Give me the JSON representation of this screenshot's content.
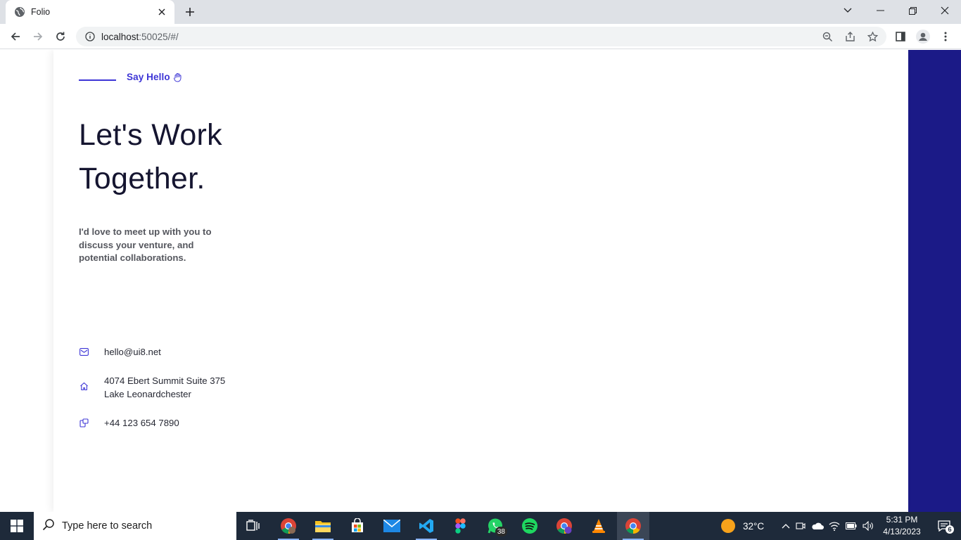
{
  "browser": {
    "tab_title": "Folio",
    "url_host": "localhost",
    "url_rest": ":50025/#/"
  },
  "page": {
    "eyebrow": "Say Hello",
    "headline": [
      "Let's Work",
      "Together."
    ],
    "intro": "I'd love to meet up with you to discuss your venture, and potential collaborations.",
    "contacts": {
      "email": "hello@ui8.net",
      "address_line1": "4074 Ebert Summit Suite 375",
      "address_line2": "Lake Leonardchester",
      "phone": "+44 123 654 7890"
    },
    "colors": {
      "accent": "#3d35d6",
      "side_band": "#1b1a87",
      "heading": "#151530"
    }
  },
  "taskbar": {
    "search_placeholder": "Type here to search",
    "whatsapp_badge": "38",
    "weather": "32°C",
    "time": "5:31 PM",
    "date": "4/13/2023",
    "notification_count": "6"
  }
}
